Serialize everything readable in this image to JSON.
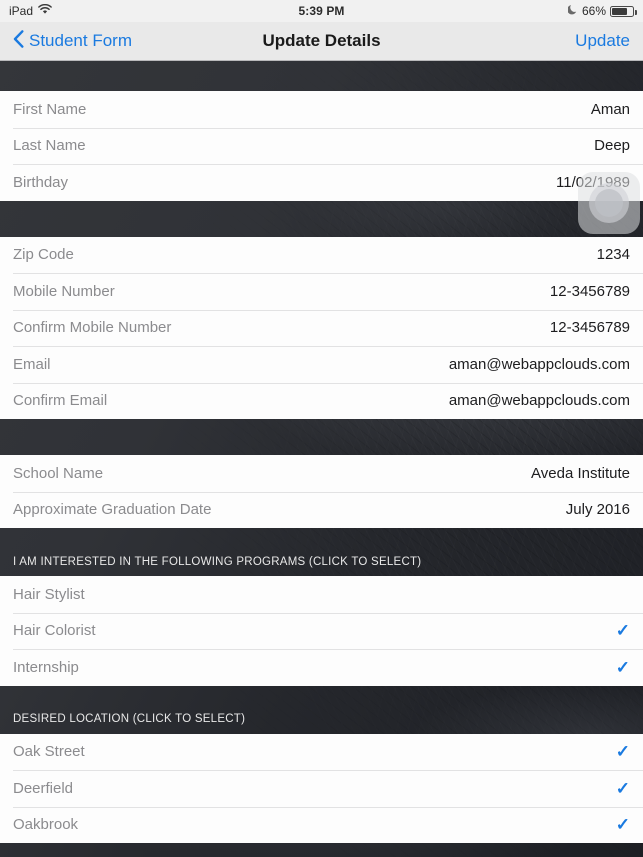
{
  "status_bar": {
    "device": "iPad",
    "wifi_icon": "wifi-icon",
    "time": "5:39 PM",
    "dnd_icon": "moon-icon",
    "battery_percent": "66%",
    "battery_icon": "battery-icon",
    "battery_level": 66
  },
  "nav_bar": {
    "back_icon": "chevron-left-icon",
    "back_label": "Student Form",
    "title": "Update Details",
    "action_label": "Update"
  },
  "theme": {
    "accent": "#1a7ae0",
    "label_color": "#8b8b8e",
    "value_color": "#1d1d1f",
    "card_bg": "#fdfdfd",
    "nav_bg": "#e9e9e9",
    "status_bg": "#f1f1f1"
  },
  "sections": [
    {
      "id": "personal",
      "header": null,
      "rows": [
        {
          "label": "First Name",
          "value": "Aman"
        },
        {
          "label": "Last Name",
          "value": "Deep"
        },
        {
          "label": "Birthday",
          "value": "11/02/1989"
        }
      ]
    },
    {
      "id": "contact",
      "header": null,
      "rows": [
        {
          "label": "Zip Code",
          "value": "1234"
        },
        {
          "label": "Mobile Number",
          "value": "12-3456789"
        },
        {
          "label": "Confirm Mobile Number",
          "value": "12-3456789"
        },
        {
          "label": "Email",
          "value": "aman@webappclouds.com"
        },
        {
          "label": "Confirm Email",
          "value": "aman@webappclouds.com"
        }
      ]
    },
    {
      "id": "school",
      "header": null,
      "rows": [
        {
          "label": "School Name",
          "value": "Aveda Institute"
        },
        {
          "label": "Approximate Graduation Date",
          "value": "July 2016"
        }
      ]
    },
    {
      "id": "programs",
      "header": "I am interested in the following programs (click to select)",
      "rows": [
        {
          "label": "Hair Stylist",
          "selected": false
        },
        {
          "label": "Hair Colorist",
          "selected": true
        },
        {
          "label": "Internship",
          "selected": true
        }
      ]
    },
    {
      "id": "location",
      "header": "Desired Location (click to select)",
      "rows": [
        {
          "label": "Oak Street",
          "selected": true
        },
        {
          "label": "Deerfield",
          "selected": true
        },
        {
          "label": "Oakbrook",
          "selected": true
        }
      ]
    }
  ],
  "assistive_touch": {
    "name": "assistive-touch-button"
  },
  "check_glyph": "✓"
}
